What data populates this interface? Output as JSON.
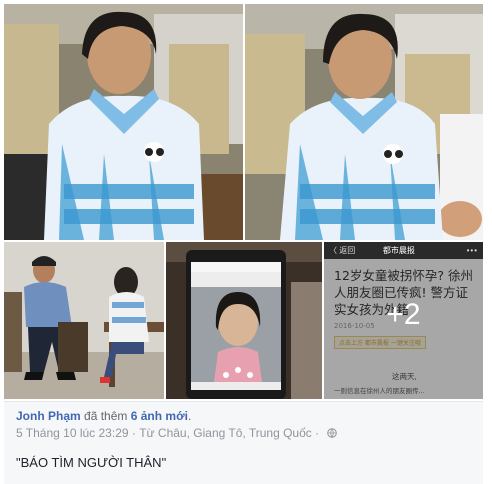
{
  "photos": [
    {
      "kind": "girl-in-car"
    },
    {
      "kind": "girl-in-car-2"
    },
    {
      "kind": "police-office"
    },
    {
      "kind": "phone-photo"
    },
    {
      "kind": "article-thumbnail"
    }
  ],
  "article": {
    "back_label": "〈 返回",
    "header_title": "都市晨报",
    "more_icon": "more-dots-icon",
    "headline": "12岁女童被拐怀孕? 徐州人朋友圈已传疯! 警方证实女孩为外籍",
    "date": "2016-10-05",
    "chip_label": "点击上方 都市晨报 一键关注哦",
    "text_1": "这两天,",
    "text_2": "一则信息在徐州人的朋友圈传...",
    "more_count": "+2"
  },
  "post": {
    "author": "Jonh Phạm",
    "action_text": " đã thêm ",
    "added_count": "6 ảnh mới",
    "action_end": ".",
    "timestamp": "5 Tháng 10 lúc 23:29",
    "separator": " · ",
    "location": "Từ Châu, Giang Tô, Trung Quốc",
    "separator2": " · ",
    "privacy_icon": "globe-icon",
    "caption": "\"BÁO TÌM NGƯỜI THÂN\""
  },
  "colors": {
    "link": "#4267b2",
    "meta": "#90949c",
    "footer_bg": "#f6f7f9"
  }
}
